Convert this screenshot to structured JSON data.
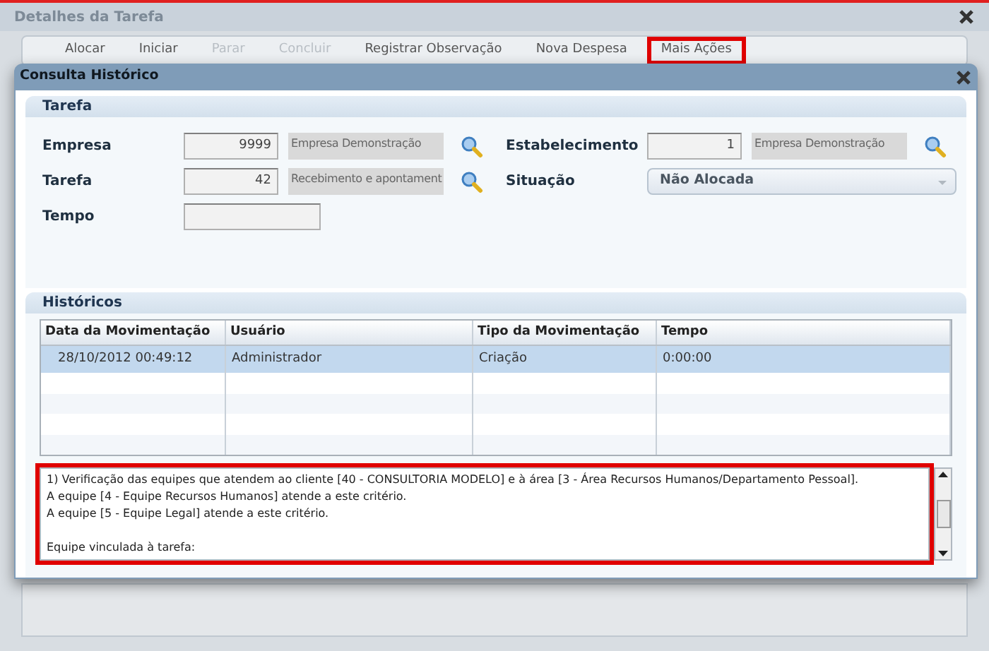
{
  "window": {
    "title": "Detalhes da Tarefa"
  },
  "toolbar": [
    {
      "label": "Alocar",
      "disabled": false,
      "highlighted": false
    },
    {
      "label": "Iniciar",
      "disabled": false,
      "highlighted": false
    },
    {
      "label": "Parar",
      "disabled": true,
      "highlighted": false
    },
    {
      "label": "Concluir",
      "disabled": true,
      "highlighted": false
    },
    {
      "label": "Registrar Observação",
      "disabled": false,
      "highlighted": false
    },
    {
      "label": "Nova Despesa",
      "disabled": false,
      "highlighted": false
    },
    {
      "label": "Mais Ações",
      "disabled": false,
      "highlighted": true
    }
  ],
  "dialog": {
    "title": "Consulta Histórico",
    "tarefa_section": {
      "title": "Tarefa",
      "left_fields": [
        {
          "label": "Empresa",
          "code": "9999",
          "description": "Empresa Demonstração",
          "kind": "lookup"
        },
        {
          "label": "Tarefa",
          "code": "42",
          "description": "Recebimento e apontament",
          "kind": "lookup"
        },
        {
          "label": "Tempo",
          "kind": "text"
        }
      ],
      "right_fields": [
        {
          "label": "Estabelecimento",
          "code": "1",
          "description": "Empresa Demonstração",
          "kind": "lookup"
        },
        {
          "label": "Situação",
          "value": "Não Alocada",
          "kind": "select"
        }
      ]
    },
    "historicos_section": {
      "title": "Históricos",
      "table": {
        "columns": [
          "Data da Movimentação",
          "Usuário",
          "Tipo da Movimentação",
          "Tempo"
        ],
        "rows": [
          {
            "cells": [
              "28/10/2012 00:49:12",
              "Administrador",
              "Criação",
              "0:00:00"
            ],
            "selected": true
          }
        ]
      }
    },
    "notes": {
      "highlighted": true,
      "paragraphs": [
        {
          "lines": [
            "1) Verificação das equipes que atendem ao cliente [40 - CONSULTORIA MODELO] e à área [3 - Área Recursos Humanos/Departamento Pessoal].",
            "A equipe [4 - Equipe Recursos Humanos] atende a este critério.",
            "A equipe [5 - Equipe Legal] atende a este critério."
          ]
        },
        {
          "lines": [
            "Equipe vinculada à tarefa:"
          ]
        }
      ]
    }
  }
}
